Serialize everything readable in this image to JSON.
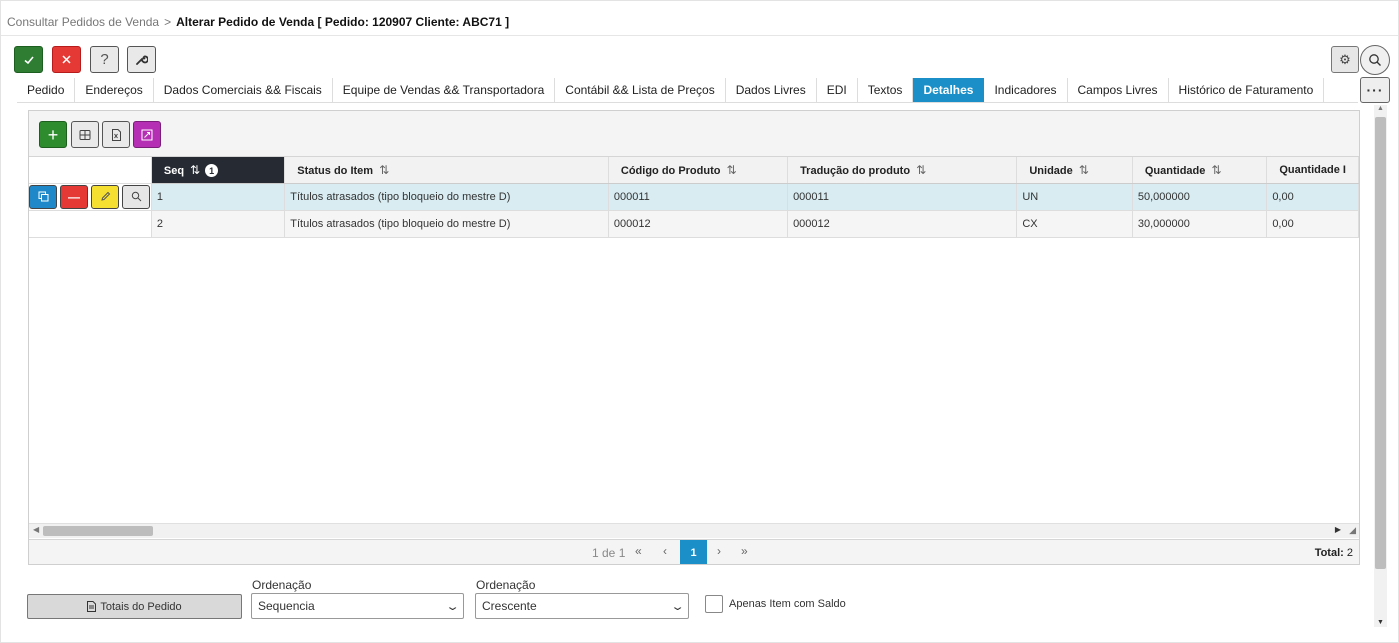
{
  "breadcrumb": {
    "parent": "Consultar Pedidos de Venda",
    "separator": ">",
    "current": "Alterar Pedido de Venda [ Pedido: 120907 Cliente: ABC71 ]"
  },
  "toolbar": {
    "confirm_icon": "check-icon",
    "cancel_icon": "close-icon",
    "help_label": "?",
    "tools_icon": "wrench-icon",
    "settings_icon": "gear-icon",
    "search_icon": "search-icon",
    "more_label": "···"
  },
  "tabs": [
    {
      "label": "Pedido"
    },
    {
      "label": "Endereços"
    },
    {
      "label": "Dados Comerciais && Fiscais"
    },
    {
      "label": "Equipe de Vendas && Transportadora"
    },
    {
      "label": "Contábil && Lista de Preços"
    },
    {
      "label": "Dados Livres"
    },
    {
      "label": "EDI"
    },
    {
      "label": "Textos"
    },
    {
      "label": "Detalhes"
    },
    {
      "label": "Indicadores"
    },
    {
      "label": "Campos Livres"
    },
    {
      "label": "Histórico de Faturamento"
    }
  ],
  "active_tab": "Detalhes",
  "grid": {
    "columns": [
      {
        "label": "Seq",
        "sort_order": "1"
      },
      {
        "label": "Status do Item"
      },
      {
        "label": "Código do Produto"
      },
      {
        "label": "Tradução do produto"
      },
      {
        "label": "Unidade"
      },
      {
        "label": "Quantidade"
      },
      {
        "label": "Quantidade I"
      }
    ],
    "rows": [
      {
        "seq": "1",
        "status": "Títulos atrasados (tipo bloqueio do mestre D)",
        "codigo": "000011",
        "traducao": "000011",
        "unidade": "UN",
        "quantidade": "50,000000",
        "quantidade2": "0,00"
      },
      {
        "seq": "2",
        "status": "Títulos atrasados (tipo bloqueio do mestre D)",
        "codigo": "000012",
        "traducao": "000012",
        "unidade": "CX",
        "quantidade": "30,000000",
        "quantidade2": "0,00"
      }
    ]
  },
  "pager": {
    "info": "1 de 1",
    "first": "«",
    "prev": "‹",
    "current_page": "1",
    "next": "›",
    "last": "»",
    "total_label": "Total:",
    "total_value": "2"
  },
  "footer": {
    "totals_button": "Totais do Pedido",
    "ordenacao1_label": "Ordenação",
    "ordenacao1_value": "Sequencia",
    "ordenacao2_label": "Ordenação",
    "ordenacao2_value": "Crescente",
    "checkbox_label": "Apenas Item com Saldo"
  },
  "colors": {
    "accent": "#1a8fc8",
    "confirm": "#2e7d32",
    "cancel": "#e53935",
    "selected_row": "#d8ecf2",
    "sorted_header": "#262b33"
  }
}
